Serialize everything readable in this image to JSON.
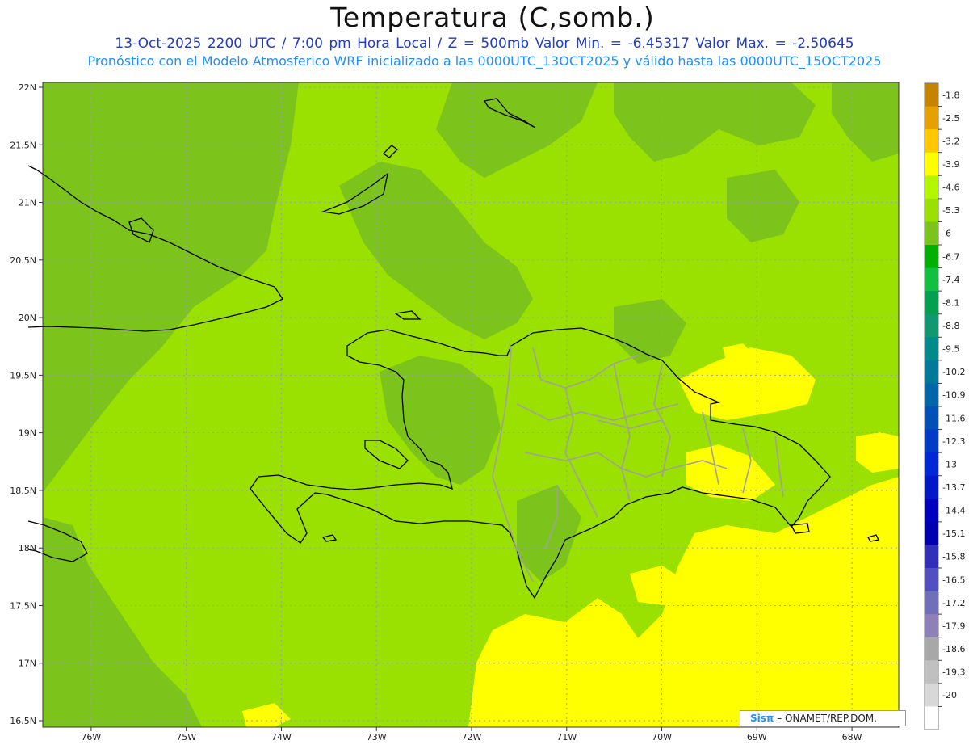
{
  "header": {
    "title": "Temperatura (C,somb.)",
    "subtitle_line1": "13-Oct-2025  2200 UTC / 7:00 pm Hora Local / Z = 500mb  Valor Min. = -6.45317  Valor Max. = -2.50645",
    "subtitle_line2": "Pronóstico con el Modelo Atmosferico WRF inicializado a las 0000UTC_13OCT2025 y válido hasta las  0000UTC_15OCT2025"
  },
  "map": {
    "lat_labels": [
      "22N",
      "21.5N",
      "21N",
      "20.5N",
      "20N",
      "19.5N",
      "19N",
      "18.5N",
      "18N",
      "17.5N",
      "17N",
      "16.5N"
    ],
    "lon_labels": [
      "76W",
      "75W",
      "74W",
      "73W",
      "72W",
      "71W",
      "70W",
      "69W",
      "68W"
    ],
    "lat_range": [
      16.5,
      22
    ],
    "lon_range": [
      -76.5,
      -67.5
    ],
    "background_color": "#9ae000",
    "regions": [
      {
        "name": "west-dark-band",
        "color": "#7cc41c"
      },
      {
        "name": "southeast-warm-area",
        "color": "#ffff00"
      }
    ],
    "coastline_color": "#000000",
    "province_border_color": "#a0a0a0",
    "gridlines": true
  },
  "colorbar": {
    "labels": [
      "-1.8",
      "-2.5",
      "-3.2",
      "-3.9",
      "-4.6",
      "-5.3",
      "-6",
      "-6.7",
      "-7.4",
      "-8.1",
      "-8.8",
      "-9.5",
      "-10.2",
      "-10.9",
      "-11.6",
      "-12.3",
      "-13",
      "-13.7",
      "-14.4",
      "-15.1",
      "-15.8",
      "-16.5",
      "-17.2",
      "-17.9",
      "-18.6",
      "-19.3",
      "-20"
    ],
    "colors": [
      "#c48400",
      "#e6a000",
      "#ffc800",
      "#ffff00",
      "#b4f500",
      "#9ae000",
      "#7cc41c",
      "#00b000",
      "#10c040",
      "#00a050",
      "#109870",
      "#008a8a",
      "#007898",
      "#0066a8",
      "#0050b8",
      "#003cc8",
      "#0028d8",
      "#0018c8",
      "#0000c0",
      "#0000b0",
      "#3030b8",
      "#5050c0",
      "#7070b8",
      "#9080b8",
      "#a8a8a8",
      "#c0c0c0",
      "#d8d8d8",
      "#ffffff"
    ]
  },
  "credit": {
    "logo": "Sisπ",
    "text": "– ONAMET/REP.DOM."
  }
}
